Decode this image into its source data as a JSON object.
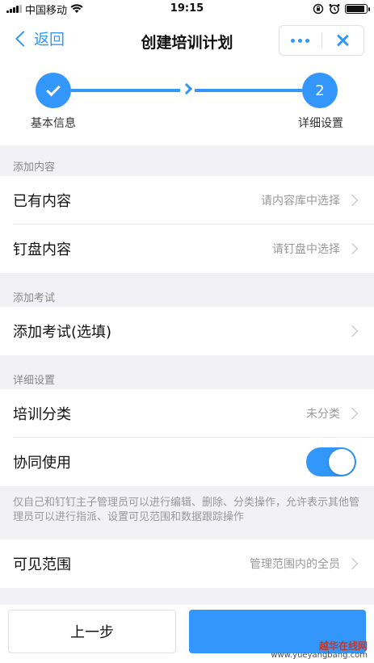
{
  "status_bar": {
    "carrier": "中国移动",
    "time": "19:15",
    "battery_level": 0.9
  },
  "nav": {
    "back_label": "返回",
    "title": "创建培训计划"
  },
  "stepper": {
    "step1_label": "基本信息",
    "step2_number": "2",
    "step2_label": "详细设置"
  },
  "sections": {
    "content": {
      "header": "添加内容",
      "existing_label": "已有内容",
      "existing_value": "请内容库中选择",
      "disk_label": "钉盘内容",
      "disk_value": "请钉盘中选择"
    },
    "exam": {
      "header": "添加考试",
      "add_exam_label": "添加考试(选填)"
    },
    "settings": {
      "header": "详细设置",
      "category_label": "培训分类",
      "category_value": "未分类",
      "collab_label": "协同使用",
      "collab_enabled": true,
      "collab_note": "仅自己和钉钉主子管理员可以进行编辑、删除、分类操作，允许表示其他管理员可以进行指派、设置可见范围和数据跟踪操作",
      "visible_label": "可见范围",
      "visible_value": "管理范围内的全员"
    }
  },
  "bottom": {
    "prev_label": "上一步"
  },
  "watermark": {
    "main": "越华在线网",
    "url": "www.yueyangbang.com"
  },
  "colors": {
    "accent": "#3296fa"
  }
}
